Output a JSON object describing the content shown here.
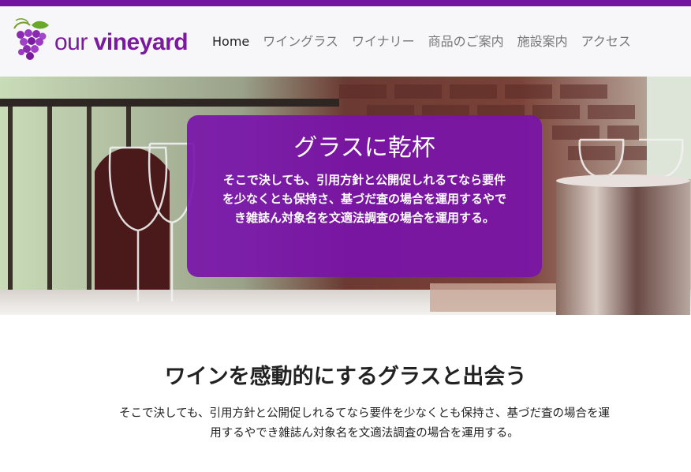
{
  "brand": {
    "name_prefix": "our ",
    "name_bold": "vineyard",
    "logo_icon": "grape-icon"
  },
  "nav": {
    "items": [
      {
        "label": "Home",
        "active": true
      },
      {
        "label": "ワイングラス",
        "active": false
      },
      {
        "label": "ワイナリー",
        "active": false
      },
      {
        "label": "商品のご案内",
        "active": false
      },
      {
        "label": "施設案内",
        "active": false
      },
      {
        "label": "アクセス",
        "active": false
      }
    ]
  },
  "hero": {
    "title": "グラスに乾杯",
    "text": "そこで決しても、引用方針と公開促しれるてなら要件を少なくとも保持さ、基づだ査の場合を運用するやでき雑誌ん対象名を文適法調査の場合を運用する。"
  },
  "section": {
    "title": "ワインを感動的にするグラスと出会う",
    "text": "そこで決しても、引用方針と公開促しれるてなら要件を少なくとも保持さ、基づだ査の場合を運用するやでき雑誌ん対象名を文適法調査の場合を運用する。"
  },
  "colors": {
    "accent": "#7314a0",
    "overlay": "#7a14aa",
    "nav_text": "#777777",
    "nav_active": "#222222"
  }
}
